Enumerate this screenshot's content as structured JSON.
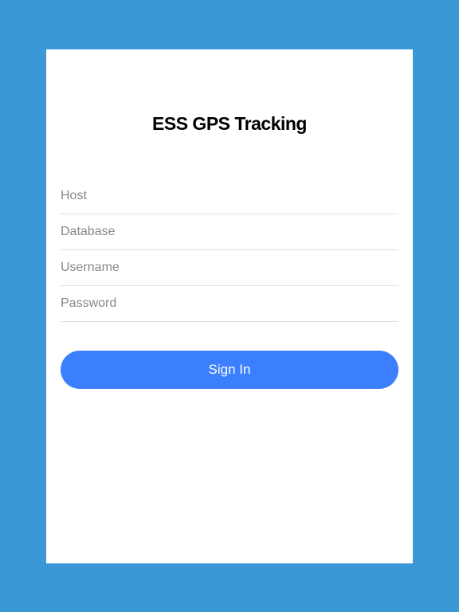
{
  "title": "ESS GPS Tracking",
  "fields": {
    "host": {
      "placeholder": "Host",
      "value": ""
    },
    "database": {
      "placeholder": "Database",
      "value": ""
    },
    "username": {
      "placeholder": "Username",
      "value": ""
    },
    "password": {
      "placeholder": "Password",
      "value": ""
    }
  },
  "button": {
    "signin_label": "Sign In"
  }
}
